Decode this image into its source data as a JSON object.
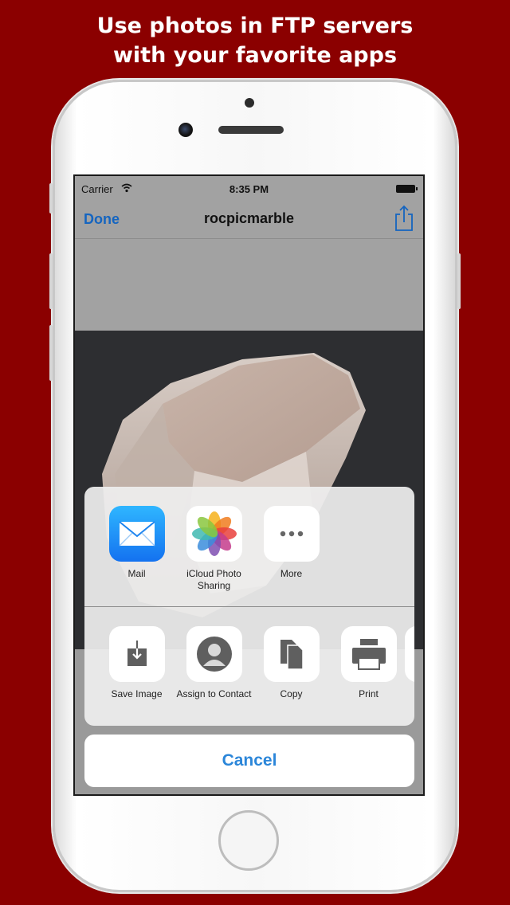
{
  "headline": {
    "line1": "Use photos in FTP servers",
    "line2": "with your favorite apps"
  },
  "statusbar": {
    "carrier": "Carrier",
    "time": "8:35 PM"
  },
  "navbar": {
    "done_label": "Done",
    "title": "rocpicmarble"
  },
  "share_sheet": {
    "apps": [
      {
        "label": "Mail",
        "icon": "mail-icon"
      },
      {
        "label": "iCloud Photo Sharing",
        "icon": "photos-icon"
      },
      {
        "label": "More",
        "icon": "more-icon"
      }
    ],
    "actions": [
      {
        "label": "Save Image",
        "icon": "save-image-icon"
      },
      {
        "label": "Assign to Contact",
        "icon": "contact-icon"
      },
      {
        "label": "Copy",
        "icon": "copy-icon"
      },
      {
        "label": "Print",
        "icon": "print-icon"
      }
    ],
    "cancel_label": "Cancel"
  },
  "colors": {
    "background": "#8b0000",
    "ios_blue": "#1565c0",
    "cancel_blue": "#2b86d9"
  }
}
